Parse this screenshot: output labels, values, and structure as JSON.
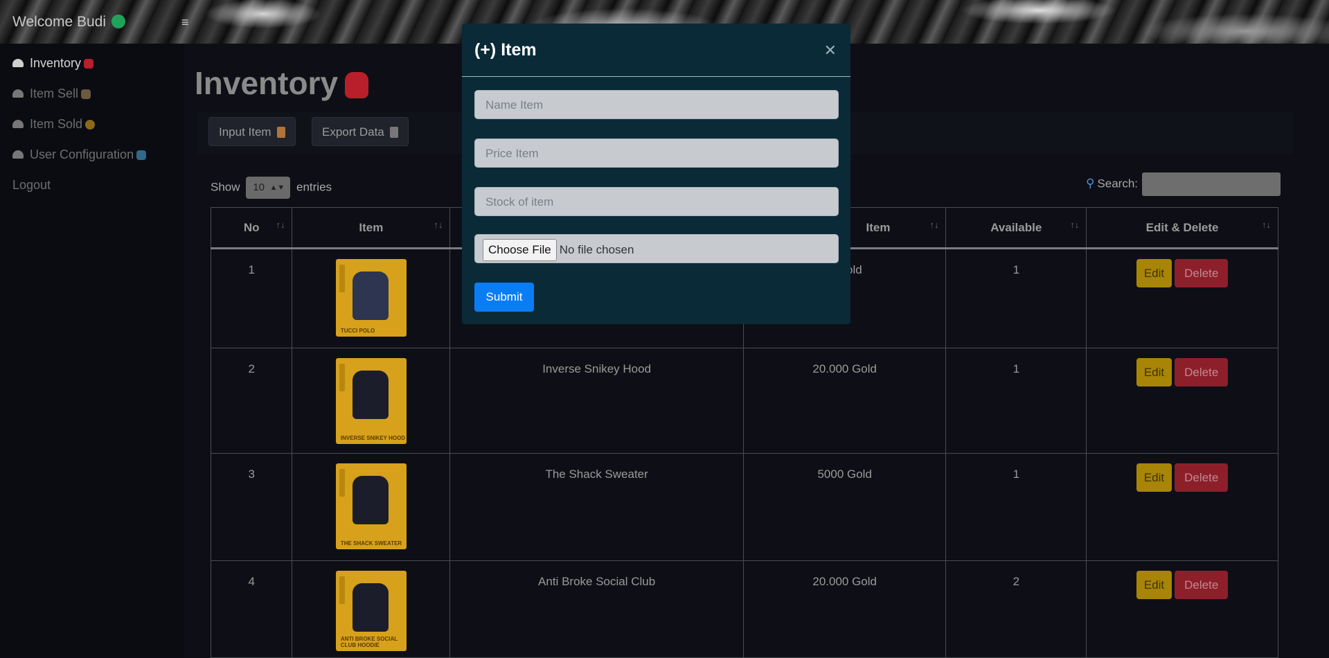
{
  "header": {
    "welcome": "Welcome Budi",
    "menu_icon": "hamburger-icon"
  },
  "sidebar": {
    "items": [
      {
        "label": "Inventory",
        "active": true
      },
      {
        "label": "Item Sell",
        "active": false
      },
      {
        "label": "Item Sold",
        "active": false
      },
      {
        "label": "User Configuration",
        "active": false
      }
    ],
    "logout": "Logout"
  },
  "main": {
    "title": "Inventory",
    "input_item_label": "Input Item",
    "export_label": "Export Data",
    "show_label": "Show",
    "entries_value": "10",
    "entries_label": "entries",
    "search_label": "Search:"
  },
  "table": {
    "headers": [
      "No",
      "Item",
      "Item",
      "Available",
      "Edit & Delete"
    ],
    "edit_label": "Edit",
    "delete_label": "Delete",
    "rows": [
      {
        "no": "1",
        "card_caption": "TUCCI POLO",
        "name": "",
        "price": "0 Gold",
        "available": "1"
      },
      {
        "no": "2",
        "card_caption": "INVERSE SNIKEY HOOD",
        "name": "Inverse Snikey Hood",
        "price": "20.000 Gold",
        "available": "1"
      },
      {
        "no": "3",
        "card_caption": "THE SHACK SWEATER",
        "name": "The Shack Sweater",
        "price": "5000 Gold",
        "available": "1"
      },
      {
        "no": "4",
        "card_caption": "ANTI BROKE SOCIAL CLUB HOODIE",
        "name": "Anti Broke Social Club",
        "price": "20.000 Gold",
        "available": "2"
      }
    ]
  },
  "modal": {
    "title": "(+) Item",
    "close_icon": "close-icon",
    "name_placeholder": "Name Item",
    "price_placeholder": "Price Item",
    "stock_placeholder": "Stock of item",
    "file_button": "Choose File",
    "file_status": "No file chosen",
    "submit_label": "Submit"
  },
  "colors": {
    "accent": "#0a7df5",
    "modal_bg": "#0a2a38",
    "edit": "#a88507",
    "delete": "#8d1f2b"
  }
}
